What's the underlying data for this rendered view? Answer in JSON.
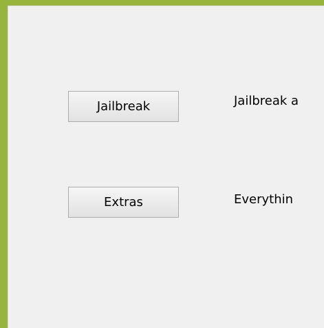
{
  "colors": {
    "frame": "#97b43c",
    "background": "#f0f0f0",
    "button_border": "#adadad"
  },
  "main": {
    "jailbreak_button_label": "Jailbreak",
    "jailbreak_description": "Jailbreak a",
    "extras_button_label": "Extras",
    "extras_description": "Everythin"
  }
}
